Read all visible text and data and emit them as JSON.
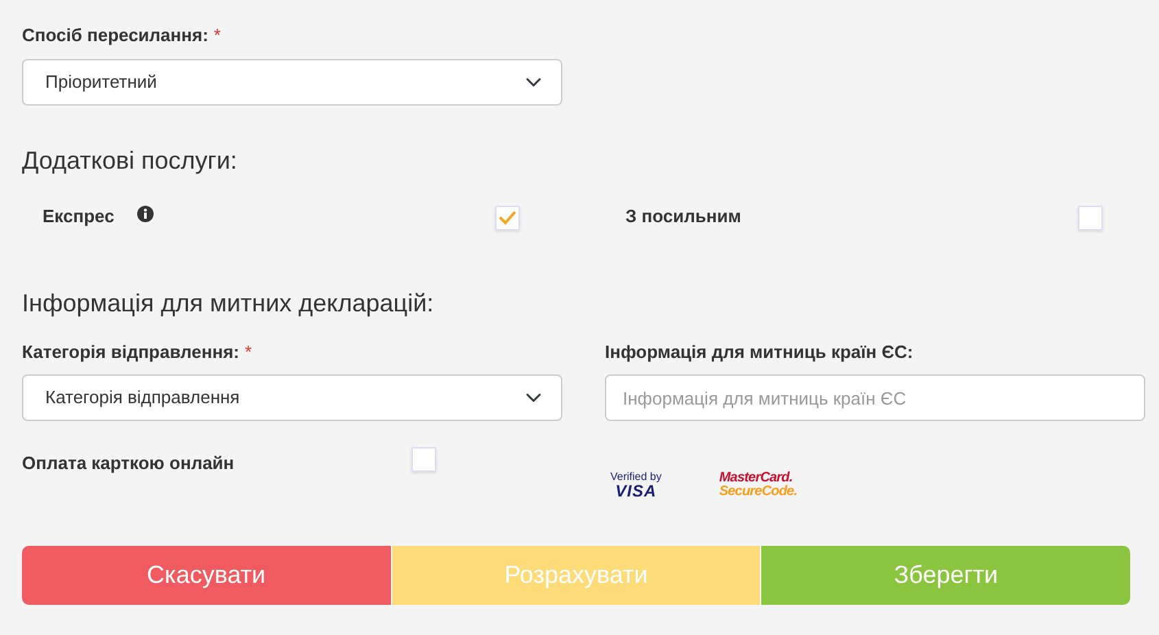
{
  "shipping": {
    "label": "Спосіб пересилання:",
    "required_mark": "*",
    "value": "Пріоритетний"
  },
  "services": {
    "heading": "Додаткові послуги:",
    "items": [
      {
        "label": "Експрес",
        "info": true,
        "checked": true
      },
      {
        "label": "З посильним",
        "info": false,
        "checked": false
      }
    ]
  },
  "customs": {
    "heading": "Інформація для митних декларацій:",
    "category": {
      "label": "Категорія відправлення:",
      "required_mark": "*",
      "value": "Категорія відправлення"
    },
    "eu_info": {
      "label": "Інформація для митниць країн ЄС:",
      "placeholder": "Інформація для митниць країн ЄС"
    }
  },
  "card_payment": {
    "label": "Оплата карткою онлайн",
    "checked": false,
    "logos": [
      {
        "kind": "visa",
        "lines": [
          "Verified by",
          "VISA"
        ]
      },
      {
        "kind": "mastercard",
        "lines": [
          "MasterCard.",
          "SecureCode."
        ]
      }
    ]
  },
  "buttons": [
    {
      "label": "Скасувати",
      "kind": "cancel"
    },
    {
      "label": "Розрахувати",
      "kind": "calculate"
    },
    {
      "label": "Зберегти",
      "kind": "save"
    }
  ]
}
